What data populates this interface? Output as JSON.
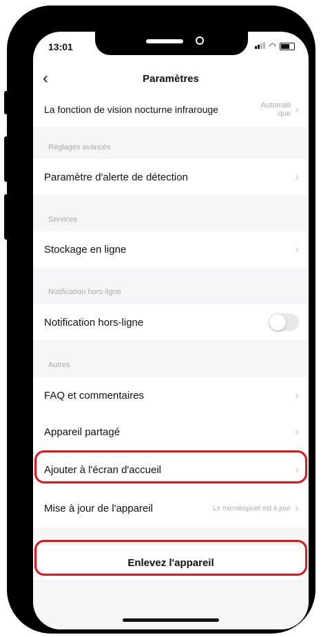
{
  "status": {
    "time": "13:01"
  },
  "header": {
    "title": "Paramètres"
  },
  "rows": {
    "night_vision": {
      "label": "La fonction de vision nocturne infrarouge",
      "value_line1": "Automati",
      "value_line2": "que"
    },
    "detection_alert": {
      "label": "Paramètre d'alerte de détection"
    },
    "cloud_storage": {
      "label": "Stockage en ligne"
    },
    "offline_notification": {
      "label": "Notification hors-ligne",
      "enabled": false
    },
    "faq": {
      "label": "FAQ et commentaires"
    },
    "shared_device": {
      "label": "Appareil partagé"
    },
    "add_home_screen": {
      "label": "Ajouter à l'écran d'accueil"
    },
    "device_update": {
      "label": "Mise à jour de l'appareil",
      "value": "Le micrologiciel est à jour"
    }
  },
  "sections": {
    "advanced": "Réglages avancés",
    "services": "Services",
    "offline_notification": "Notification hors-ligne",
    "others": "Autres"
  },
  "remove_button": {
    "label": "Enlevez l'appareil"
  },
  "colors": {
    "highlight": "#e3121b",
    "section_bg": "#f5f5f7"
  }
}
